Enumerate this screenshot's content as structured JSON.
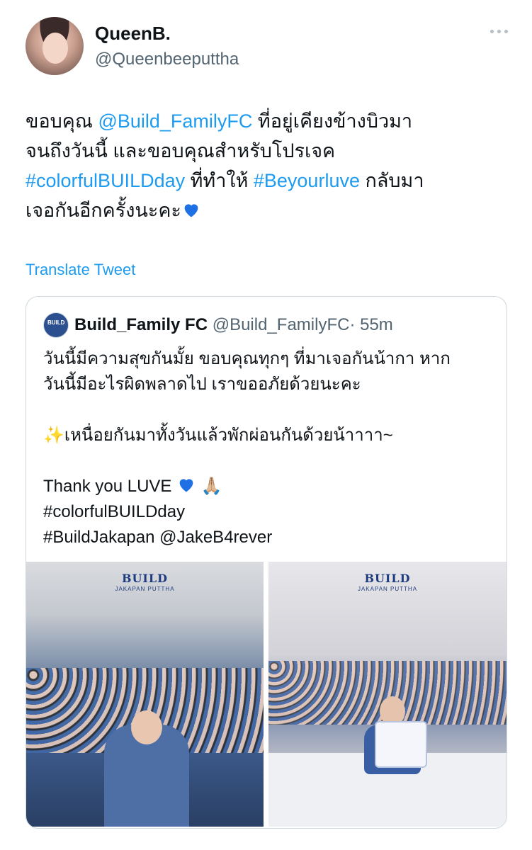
{
  "author": {
    "display_name": "QueenB.",
    "handle": "@Queenbeeputtha"
  },
  "tweet": {
    "line1_pre": "ขอบคุณ ",
    "line1_mention": "@Build_FamilyFC",
    "line1_post": "  ที่อยู่เคียงข้างบิวมา",
    "line2": "จนถึงวันนี้ และขอบคุณสำหรับโปรเจค",
    "line3_tag1": "#colorfulBUILDday",
    "line3_mid": " ที่ทำให้ ",
    "line3_tag2": "#Beyourluve",
    "line3_post": " กลับมา",
    "line4": "เจอกันอีกครั้งนะคะ"
  },
  "translate_label": "Translate Tweet",
  "quoted": {
    "display_name": "Build_Family FC",
    "handle": "@Build_FamilyFC",
    "time": "· 55m",
    "avatar_text": "BUILD",
    "text_line1": "วันนี้มีความสุขกันมั้ย ขอบคุณทุกๆ ที่มาเจอกันน้ากา หาก",
    "text_line2": "วันนี้มีอะไรผิดพลาดไป เราขออภัยด้วยนะคะ",
    "sparkle": "✨",
    "text_line3": "เหนื่อยกันมาทั้งวันแล้วพักผ่อนกันด้วยน้าาาา~",
    "text_line4": "Thank you LUVE ",
    "text_line4_emoji": "🙏🏼",
    "text_line5": "#colorfulBUILDday",
    "text_line6": "#BuildJakapan @JakeB4rever"
  },
  "images": {
    "logo_text": "BUILD",
    "logo_sub": "JAKAPAN PUTTHA"
  },
  "colors": {
    "link": "#1d9bf0",
    "muted": "#536471",
    "heart": "#1f6fe5"
  }
}
